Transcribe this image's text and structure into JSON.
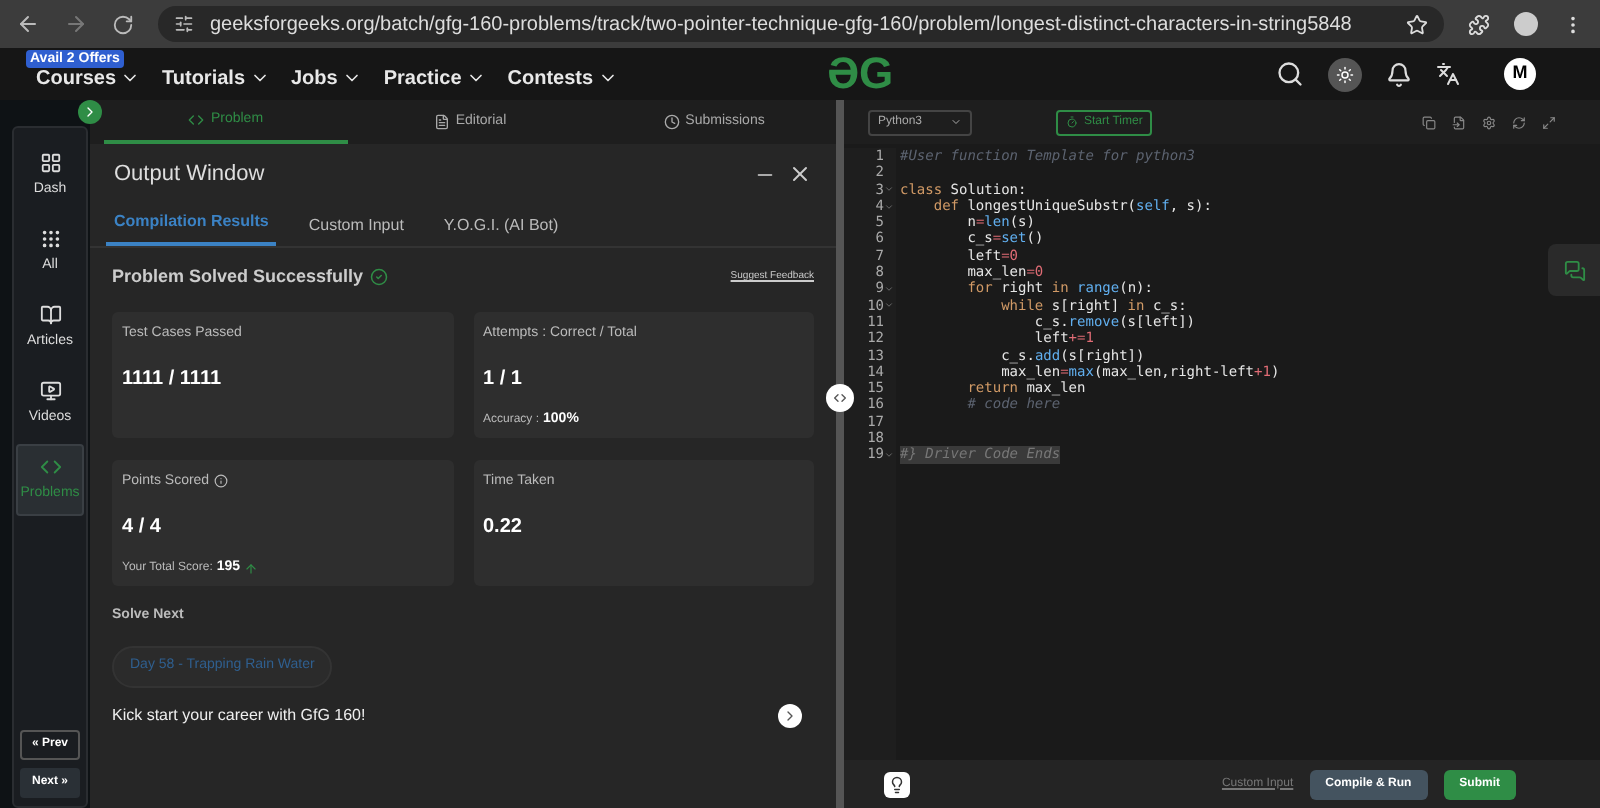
{
  "browser": {
    "url": "geeksforgeeks.org/batch/gfg-160-problems/track/two-pointer-technique-gfg-160/problem/longest-distinct-characters-in-string5848"
  },
  "nav": {
    "offer_badge": "Avail 2 Offers",
    "menus": [
      "Courses",
      "Tutorials",
      "Jobs",
      "Practice",
      "Contests"
    ],
    "logo": "ƏG",
    "avatar": "M"
  },
  "sidebar": {
    "items": [
      {
        "label": "Dash",
        "selected": false
      },
      {
        "label": "All",
        "selected": false
      },
      {
        "label": "Articles",
        "selected": false
      },
      {
        "label": "Videos",
        "selected": false
      },
      {
        "label": "Problems",
        "selected": true
      }
    ],
    "prev": "« Prev",
    "next": "Next »"
  },
  "problem_tabs": [
    {
      "label": "Problem",
      "selected": true
    },
    {
      "label": "Editorial",
      "selected": false
    },
    {
      "label": "Submissions",
      "selected": false
    }
  ],
  "output": {
    "title": "Output Window",
    "tabs": [
      {
        "label": "Compilation Results",
        "selected": true
      },
      {
        "label": "Custom Input",
        "selected": false
      },
      {
        "label": "Y.O.G.I. (AI Bot)",
        "selected": false
      }
    ],
    "status": "Problem Solved Successfully",
    "feedback": "Suggest Feedback",
    "cards": [
      {
        "label": "Test Cases Passed",
        "value": "1111 / 1111"
      },
      {
        "label": "Attempts : Correct / Total",
        "value": "1 / 1",
        "extra_label": "Accuracy :",
        "extra_value": "100%"
      },
      {
        "label": "Points Scored",
        "value": "4 / 4",
        "info": true,
        "extra_label": "Your Total Score:",
        "extra_value": "195",
        "trend_up": true
      },
      {
        "label": "Time Taken",
        "value": "0.22"
      }
    ],
    "solve_next": "Solve Next",
    "next_problem": "Day 58 - Trapping Rain Water",
    "promo": "Kick start your career with GfG 160!"
  },
  "editor": {
    "language": "Python3",
    "timer": "Start Timer",
    "lines": [
      {
        "n": "1",
        "fold": false,
        "segs": [
          {
            "t": "#User function Template for python3",
            "kind": "comment"
          }
        ]
      },
      {
        "n": "2",
        "fold": false
      },
      {
        "n": "3",
        "fold": true,
        "segs": [
          {
            "t": "class ",
            "kind": "keyword"
          },
          {
            "t": "Solution:",
            "kind": "plain"
          }
        ]
      },
      {
        "n": "4",
        "fold": true,
        "segs": [
          {
            "t": "    def ",
            "kind": "keyword"
          },
          {
            "t": "longestUniqueSubstr(",
            "kind": "plain"
          },
          {
            "t": "self",
            "kind": "builtin"
          },
          {
            "t": ", s):",
            "kind": "plain"
          }
        ]
      },
      {
        "n": "5",
        "fold": false,
        "segs": [
          {
            "t": "        n",
            "kind": "plain"
          },
          {
            "t": "=",
            "kind": "operator"
          },
          {
            "t": "len",
            "kind": "builtin"
          },
          {
            "t": "(s)",
            "kind": "plain"
          }
        ]
      },
      {
        "n": "6",
        "fold": false,
        "segs": [
          {
            "t": "        c_s",
            "kind": "plain"
          },
          {
            "t": "=",
            "kind": "operator"
          },
          {
            "t": "set",
            "kind": "builtin"
          },
          {
            "t": "()",
            "kind": "plain"
          }
        ]
      },
      {
        "n": "7",
        "fold": false,
        "segs": [
          {
            "t": "        left",
            "kind": "plain"
          },
          {
            "t": "=0",
            "kind": "operator"
          }
        ]
      },
      {
        "n": "8",
        "fold": false,
        "segs": [
          {
            "t": "        max_len",
            "kind": "plain"
          },
          {
            "t": "=0",
            "kind": "operator"
          }
        ]
      },
      {
        "n": "9",
        "fold": true,
        "segs": [
          {
            "t": "        for ",
            "kind": "keyword"
          },
          {
            "t": "right ",
            "kind": "plain"
          },
          {
            "t": "in ",
            "kind": "keyword"
          },
          {
            "t": "range",
            "kind": "builtin"
          },
          {
            "t": "(n):",
            "kind": "plain"
          }
        ]
      },
      {
        "n": "10",
        "fold": true,
        "segs": [
          {
            "t": "            while ",
            "kind": "keyword"
          },
          {
            "t": "s[right] ",
            "kind": "plain"
          },
          {
            "t": "in ",
            "kind": "keyword"
          },
          {
            "t": "c_s:",
            "kind": "plain"
          }
        ]
      },
      {
        "n": "11",
        "fold": false,
        "segs": [
          {
            "t": "                c_s.",
            "kind": "plain"
          },
          {
            "t": "remove",
            "kind": "builtin"
          },
          {
            "t": "(s[left])",
            "kind": "plain"
          }
        ]
      },
      {
        "n": "12",
        "fold": false,
        "segs": [
          {
            "t": "                left",
            "kind": "plain"
          },
          {
            "t": "+=1",
            "kind": "operator"
          }
        ]
      },
      {
        "n": "13",
        "fold": false,
        "segs": [
          {
            "t": "            c_s.",
            "kind": "plain"
          },
          {
            "t": "add",
            "kind": "builtin"
          },
          {
            "t": "(s[right])",
            "kind": "plain"
          }
        ]
      },
      {
        "n": "14",
        "fold": false,
        "segs": [
          {
            "t": "            max_len",
            "kind": "plain"
          },
          {
            "t": "=",
            "kind": "operator"
          },
          {
            "t": "max",
            "kind": "builtin"
          },
          {
            "t": "(max_len,right-left",
            "kind": "plain"
          },
          {
            "t": "+1",
            "kind": "operator"
          },
          {
            "t": ")",
            "kind": "plain"
          }
        ]
      },
      {
        "n": "15",
        "fold": false,
        "segs": [
          {
            "t": "        return ",
            "kind": "keyword"
          },
          {
            "t": "max_len",
            "kind": "plain"
          }
        ]
      },
      {
        "n": "16",
        "fold": false,
        "segs": [
          {
            "t": "        # code here",
            "kind": "comment"
          }
        ]
      },
      {
        "n": "17",
        "fold": false
      },
      {
        "n": "18",
        "fold": false
      },
      {
        "n": "19",
        "fold": true,
        "segs": [
          {
            "t": "#} Driver Code Ends",
            "kind": "selected"
          }
        ]
      }
    ],
    "custom_input": "Custom Input",
    "compile": "Compile & Run",
    "submit": "Submit"
  }
}
